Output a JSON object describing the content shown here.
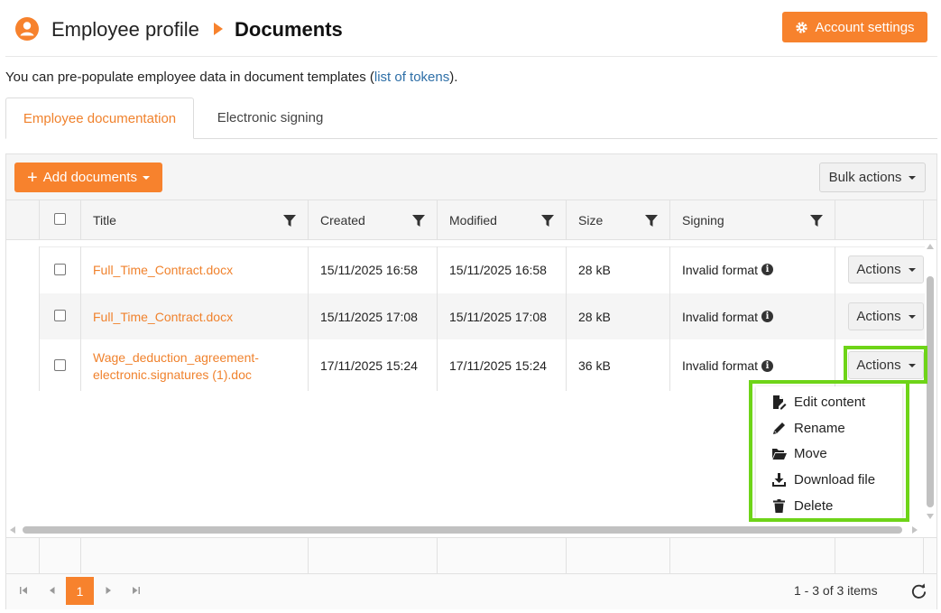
{
  "header": {
    "breadcrumb_profile": "Employee profile",
    "breadcrumb_current": "Documents",
    "account_settings_label": "Account settings",
    "accent_color": "#f7822d"
  },
  "intro": {
    "text_before": "You can pre-populate employee data in document templates (",
    "link": "list of tokens",
    "text_after": ")."
  },
  "tabs": [
    {
      "label": "Employee documentation",
      "active": true
    },
    {
      "label": "Electronic signing",
      "active": false
    }
  ],
  "toolbar": {
    "add_label": "Add documents",
    "bulk_label": "Bulk actions"
  },
  "table": {
    "columns": [
      "Title",
      "Created",
      "Modified",
      "Size",
      "Signing"
    ],
    "rows": [
      {
        "title": "Full_Time_Contract.docx",
        "created": "15/11/2025 16:58",
        "modified": "15/11/2025 16:58",
        "size": "28 kB",
        "signing": "Invalid format",
        "action": "Actions"
      },
      {
        "title": "Full_Time_Contract.docx",
        "created": "15/11/2025 17:08",
        "modified": "15/11/2025 17:08",
        "size": "28 kB",
        "signing": "Invalid format",
        "action": "Actions"
      },
      {
        "title_line1": "Wage_deduction_agreement-",
        "title_line2": "electronic.signatures (1).doc",
        "created": "17/11/2025 15:24",
        "modified": "17/11/2025 15:24",
        "size": "36 kB",
        "signing": "Invalid format",
        "action": "Actions"
      }
    ]
  },
  "menu": {
    "items": [
      {
        "label": "Edit content",
        "icon": "file-edit-icon"
      },
      {
        "label": "Rename",
        "icon": "pencil-icon"
      },
      {
        "label": "Move",
        "icon": "folder-open-icon"
      },
      {
        "label": "Download file",
        "icon": "download-icon"
      },
      {
        "label": "Delete",
        "icon": "trash-icon"
      }
    ],
    "highlight_color": "#6ed418"
  },
  "pager": {
    "current_page": "1",
    "info": "1 - 3 of 3 items"
  }
}
